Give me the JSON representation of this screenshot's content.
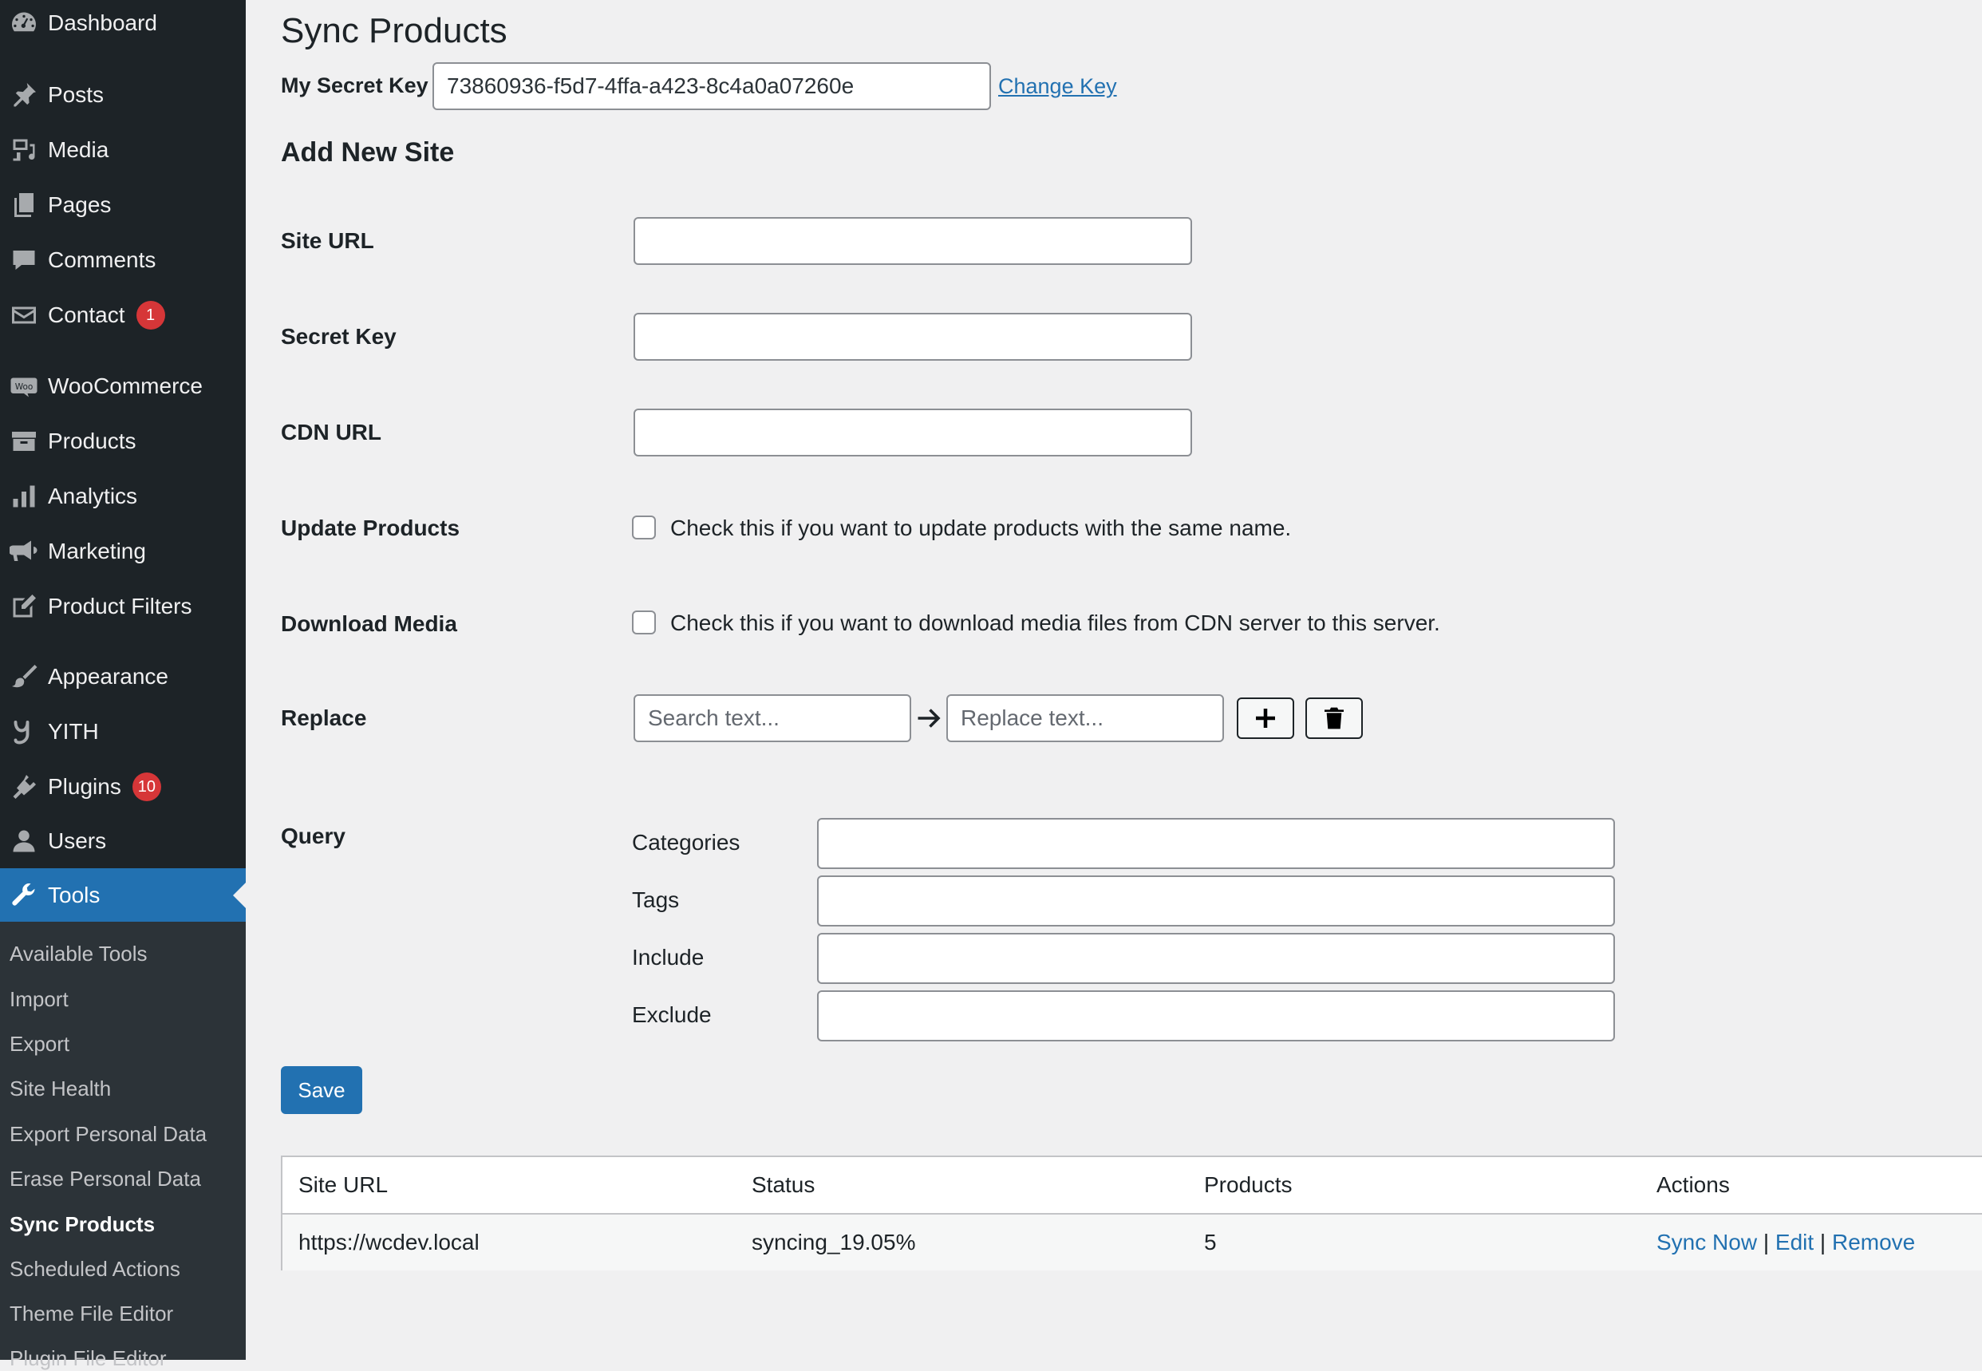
{
  "sidebar": {
    "items": [
      {
        "label": "Dashboard",
        "icon": "dashboard-icon"
      },
      {
        "label": "Posts",
        "icon": "pin-icon"
      },
      {
        "label": "Media",
        "icon": "media-icon"
      },
      {
        "label": "Pages",
        "icon": "pages-icon"
      },
      {
        "label": "Comments",
        "icon": "comment-icon"
      },
      {
        "label": "Contact",
        "icon": "mail-icon",
        "badge": "1"
      },
      {
        "label": "WooCommerce",
        "icon": "woo-icon"
      },
      {
        "label": "Products",
        "icon": "archive-icon"
      },
      {
        "label": "Analytics",
        "icon": "bar-chart-icon"
      },
      {
        "label": "Marketing",
        "icon": "megaphone-icon"
      },
      {
        "label": "Product Filters",
        "icon": "edit-icon"
      },
      {
        "label": "Appearance",
        "icon": "brush-icon"
      },
      {
        "label": "YITH",
        "icon": "yith-icon"
      },
      {
        "label": "Plugins",
        "icon": "plugin-icon",
        "badge": "10"
      },
      {
        "label": "Users",
        "icon": "user-icon"
      },
      {
        "label": "Tools",
        "icon": "wrench-icon",
        "active": true
      }
    ],
    "submenu": [
      "Available Tools",
      "Import",
      "Export",
      "Site Health",
      "Export Personal Data",
      "Erase Personal Data",
      "Sync Products",
      "Scheduled Actions",
      "Theme File Editor",
      "Plugin File Editor"
    ],
    "current_submenu": "Sync Products"
  },
  "page": {
    "title": "Sync Products",
    "secret_key_label": "My Secret Key",
    "secret_key_value": "73860936-f5d7-4ffa-a423-8c4a0a07260e",
    "change_key_link": "Change Key",
    "add_new_heading": "Add New Site"
  },
  "form": {
    "site_url_label": "Site URL",
    "secret_key_label": "Secret Key",
    "cdn_url_label": "CDN URL",
    "update_products_label": "Update Products",
    "update_products_desc": "Check this if you want to update products with the same name.",
    "download_media_label": "Download Media",
    "download_media_desc": "Check this if you want to download media files from CDN server to this server.",
    "replace_label": "Replace",
    "search_placeholder": "Search text...",
    "replace_placeholder": "Replace text...",
    "query_label": "Query",
    "query_fields": [
      "Categories",
      "Tags",
      "Include",
      "Exclude"
    ],
    "save_label": "Save"
  },
  "table": {
    "headers": [
      "Site URL",
      "Status",
      "Products",
      "Actions"
    ],
    "rows": [
      {
        "site_url": "https://wcdev.local",
        "status": "syncing_19.05%",
        "products": "5",
        "actions": [
          "Sync Now",
          "Edit",
          "Remove"
        ]
      }
    ]
  },
  "colors": {
    "sidebar_bg": "#1d2327",
    "submenu_bg": "#2c3338",
    "accent": "#2271b1",
    "badge": "#d63638",
    "page_bg": "#f0f0f1"
  }
}
